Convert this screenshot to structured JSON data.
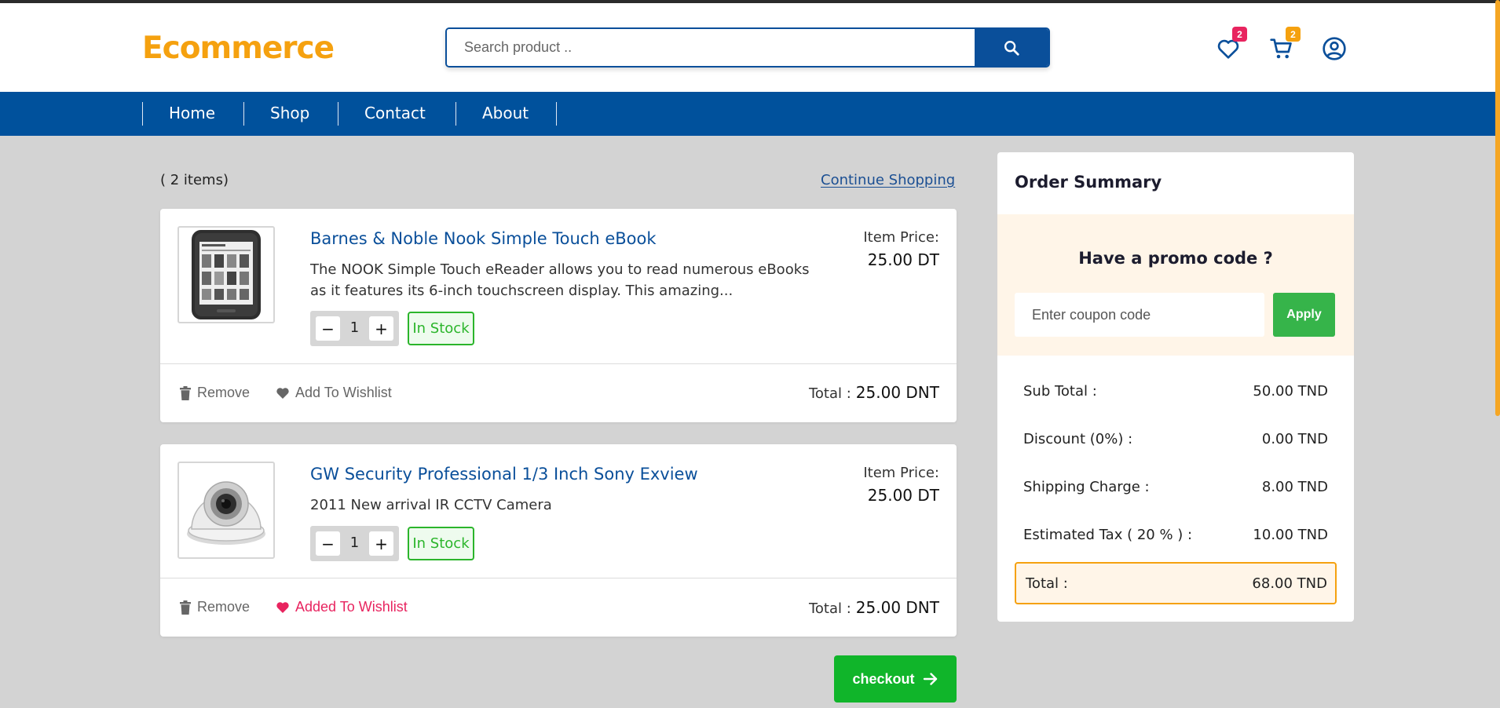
{
  "brand": {
    "logo_text": "Ecommerce",
    "accent": "#f5a10f",
    "primary": "#00519c"
  },
  "search": {
    "placeholder": "Search product .."
  },
  "header_icons": {
    "wishlist_count": "2",
    "cart_count": "2"
  },
  "nav": {
    "items": [
      "Home",
      "Shop",
      "Contact",
      "About"
    ]
  },
  "cart": {
    "items_count": "( 2 items)",
    "continue_label": "Continue Shopping",
    "price_label": "Item Price:",
    "total_label": "Total :",
    "remove_label": "Remove",
    "items": [
      {
        "title": "Barnes & Noble Nook Simple Touch eBook",
        "description": "The NOOK Simple Touch eReader allows you to read numerous eBooks as it features its 6-inch touchscreen display. This amazing...",
        "price": "25.00 DT",
        "quantity": "1",
        "stock": "In Stock",
        "wishlist_label": "Add To Wishlist",
        "total": "25.00 DNT"
      },
      {
        "title": "GW Security Professional 1/3 Inch Sony Exview",
        "description": "2011 New arrival IR CCTV Camera",
        "price": "25.00 DT",
        "quantity": "1",
        "stock": "In Stock",
        "wishlist_label": "Added To Wishlist",
        "total": "25.00 DNT"
      }
    ],
    "checkout_label": "checkout"
  },
  "summary": {
    "title": "Order Summary",
    "promo_title": "Have a promo code ?",
    "coupon_placeholder": "Enter coupon code",
    "apply_label": "Apply",
    "rows": [
      {
        "label": "Sub Total :",
        "value": "50.00 TND"
      },
      {
        "label": "Discount (0%) :",
        "value": "0.00 TND"
      },
      {
        "label": "Shipping Charge :",
        "value": "8.00 TND"
      },
      {
        "label": "Estimated Tax ( 20 % ) :",
        "value": "10.00 TND"
      }
    ],
    "total_label": "Total :",
    "total_value": "68.00 TND"
  }
}
